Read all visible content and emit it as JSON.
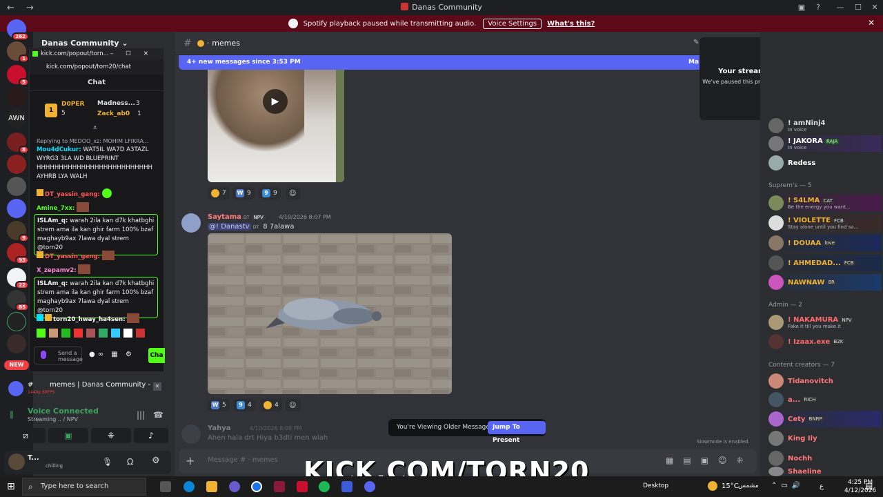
{
  "window": {
    "title": "Danas Community"
  },
  "notice": {
    "text": "Spotify playback paused while transmitting audio.",
    "button": "Voice Settings",
    "link": "What's this?"
  },
  "rail": {
    "badge_top": "262",
    "new_label": "NEW",
    "server_text": "AWN",
    "badges": [
      "1",
      "5",
      "8",
      "9",
      "93",
      "22",
      "85"
    ]
  },
  "popout": {
    "window_title": "kick.com/popout/torn...",
    "url": "kick.com/popout/torn20/chat",
    "chat_header": "Chat",
    "leader": {
      "rank": "1",
      "name": "D0PER",
      "count": "5",
      "second_name": "Madness...",
      "second_count": "3",
      "third_name": "Zack_ab0",
      "third_count": "1"
    },
    "reply_to": "Replying to MEDOO_xz: MOHIM LFIKRA...",
    "messages": [
      {
        "user": "Mou4dCukur:",
        "text": "WAT5IL WA7D A3TAZL WYRG3 3LA WD BLUEPRINT HHHHHHHHHHHHHHHHHHHHHHHHHH AYHRB LYA WALH"
      },
      {
        "user": "DT_yassin_gang:",
        "text": ""
      },
      {
        "user": "Amine_7xx:",
        "text": ""
      },
      {
        "user": "ISLAm_q:",
        "text": "warah 2ila kan d7k khatbghi strem ama ila kan ghir farm 100% bzaf maghayb9ax 7lawa dyal strem @torn20"
      },
      {
        "user": "DT_yassin_gang:",
        "text": ""
      },
      {
        "user": "X_zepamv2:",
        "text": ""
      },
      {
        "user": "ISLAm_q:",
        "text": "warah 2ila kan d7k khatbghi strem ama ila kan ghir farm 100% bzaf maghayb9ax 7lawa dyal strem @torn20"
      },
      {
        "user": "torn20_hway_ha4sen:",
        "text": ""
      }
    ],
    "input_placeholder": "Send a message",
    "chat_button": "Cha"
  },
  "voice": {
    "channel_line": "memes | Danas Community - ...",
    "quality": "1440p 60FPS",
    "status": "Voice Connected",
    "streaming": "Streaming .. / NPV",
    "user": "T...",
    "user_status": "chilling"
  },
  "channel": {
    "name": "memes",
    "new_banner": "4+ new messages since 3:53 PM",
    "mark": "Ma"
  },
  "messages": [
    {
      "author": "Saytama",
      "tag": "NPV",
      "time": "4/10/2026 8:07 PM",
      "mention": "@! Danastv",
      "text": "8 7alawa"
    },
    {
      "author": "Yahya",
      "time": "4/10/2026 8:08 PM",
      "text": "Ahen hala drt Hiya b3dti men wlah"
    }
  ],
  "reactions_top": [
    {
      "icon": "laugh",
      "count": "7"
    },
    {
      "icon": "W",
      "count": "9"
    },
    {
      "icon": "9",
      "count": "9"
    }
  ],
  "reactions_mid": [
    {
      "icon": "W",
      "count": "5"
    },
    {
      "icon": "9",
      "count": "4"
    },
    {
      "icon": "laugh",
      "count": "4"
    }
  ],
  "older": {
    "text": "You're Viewing Older Messages",
    "button": "Jump To Present"
  },
  "slowmode": "Slowmode is enabled.",
  "composer": {
    "placeholder": "Message #  ·  memes"
  },
  "overlay": {
    "text": "KICK.COM/TORN20"
  },
  "stream_notice": {
    "title": "Your stream is still running!",
    "subtitle": "We've paused this preview to save your resources."
  },
  "members": {
    "top": [
      {
        "name": "! amNinj4",
        "sub": "In voice",
        "color": "#dbdee1"
      },
      {
        "name": "! JAKORA",
        "sub": "In voice",
        "tag": "RAJA",
        "color": "#ffffff"
      },
      {
        "name": "Redess",
        "sub": "",
        "color": "#ffffff"
      }
    ],
    "supreme_header": "Suprem's — 5",
    "supreme": [
      {
        "name": "! S4LMA",
        "tag": "CAT",
        "sub": "Be the energy you want...",
        "color": "#f0b232"
      },
      {
        "name": "! VIOLETTE",
        "tag": "FCB",
        "sub": "Stay alone until you find so...",
        "color": "#f0b232"
      },
      {
        "name": "! DOUAA",
        "tag": "love",
        "sub": "",
        "color": "#f0b232"
      },
      {
        "name": "! AHMEDAD...",
        "tag": "FCB",
        "sub": "",
        "color": "#f0b232"
      },
      {
        "name": "NAWNAW",
        "tag": "8R",
        "sub": "",
        "color": "#f0b232"
      }
    ],
    "admin_header": "Admin — 2",
    "admin": [
      {
        "name": "! NAKAMURA",
        "tag": "NPV",
        "sub": "Fake it till you make it",
        "color": "#ff6b6b"
      },
      {
        "name": "! Izaax.exe",
        "tag": "B2K",
        "sub": "",
        "color": "#ff6b6b"
      }
    ],
    "creators_header": "Content creators — 7",
    "creators": [
      {
        "name": "Tidanovitch",
        "tag": "",
        "color": "#ff7a7a"
      },
      {
        "name": "a...",
        "tag": "RICH",
        "color": "#ff7a7a"
      },
      {
        "name": "Cety",
        "tag": "BNRP",
        "color": "#ff7a7a"
      },
      {
        "name": "King Ily",
        "tag": "",
        "color": "#ff7a7a"
      },
      {
        "name": "Nochh",
        "tag": "",
        "color": "#ff7a7a"
      },
      {
        "name": "Shaeline",
        "tag": "",
        "color": "#ff7a7a"
      }
    ]
  },
  "taskbar": {
    "search": "Type here to search",
    "desktop": "Desktop",
    "weather": "15°C",
    "weather_label": "مشمس",
    "time": "4:25 PM",
    "date": "4/12/2026",
    "lang": "ع"
  }
}
